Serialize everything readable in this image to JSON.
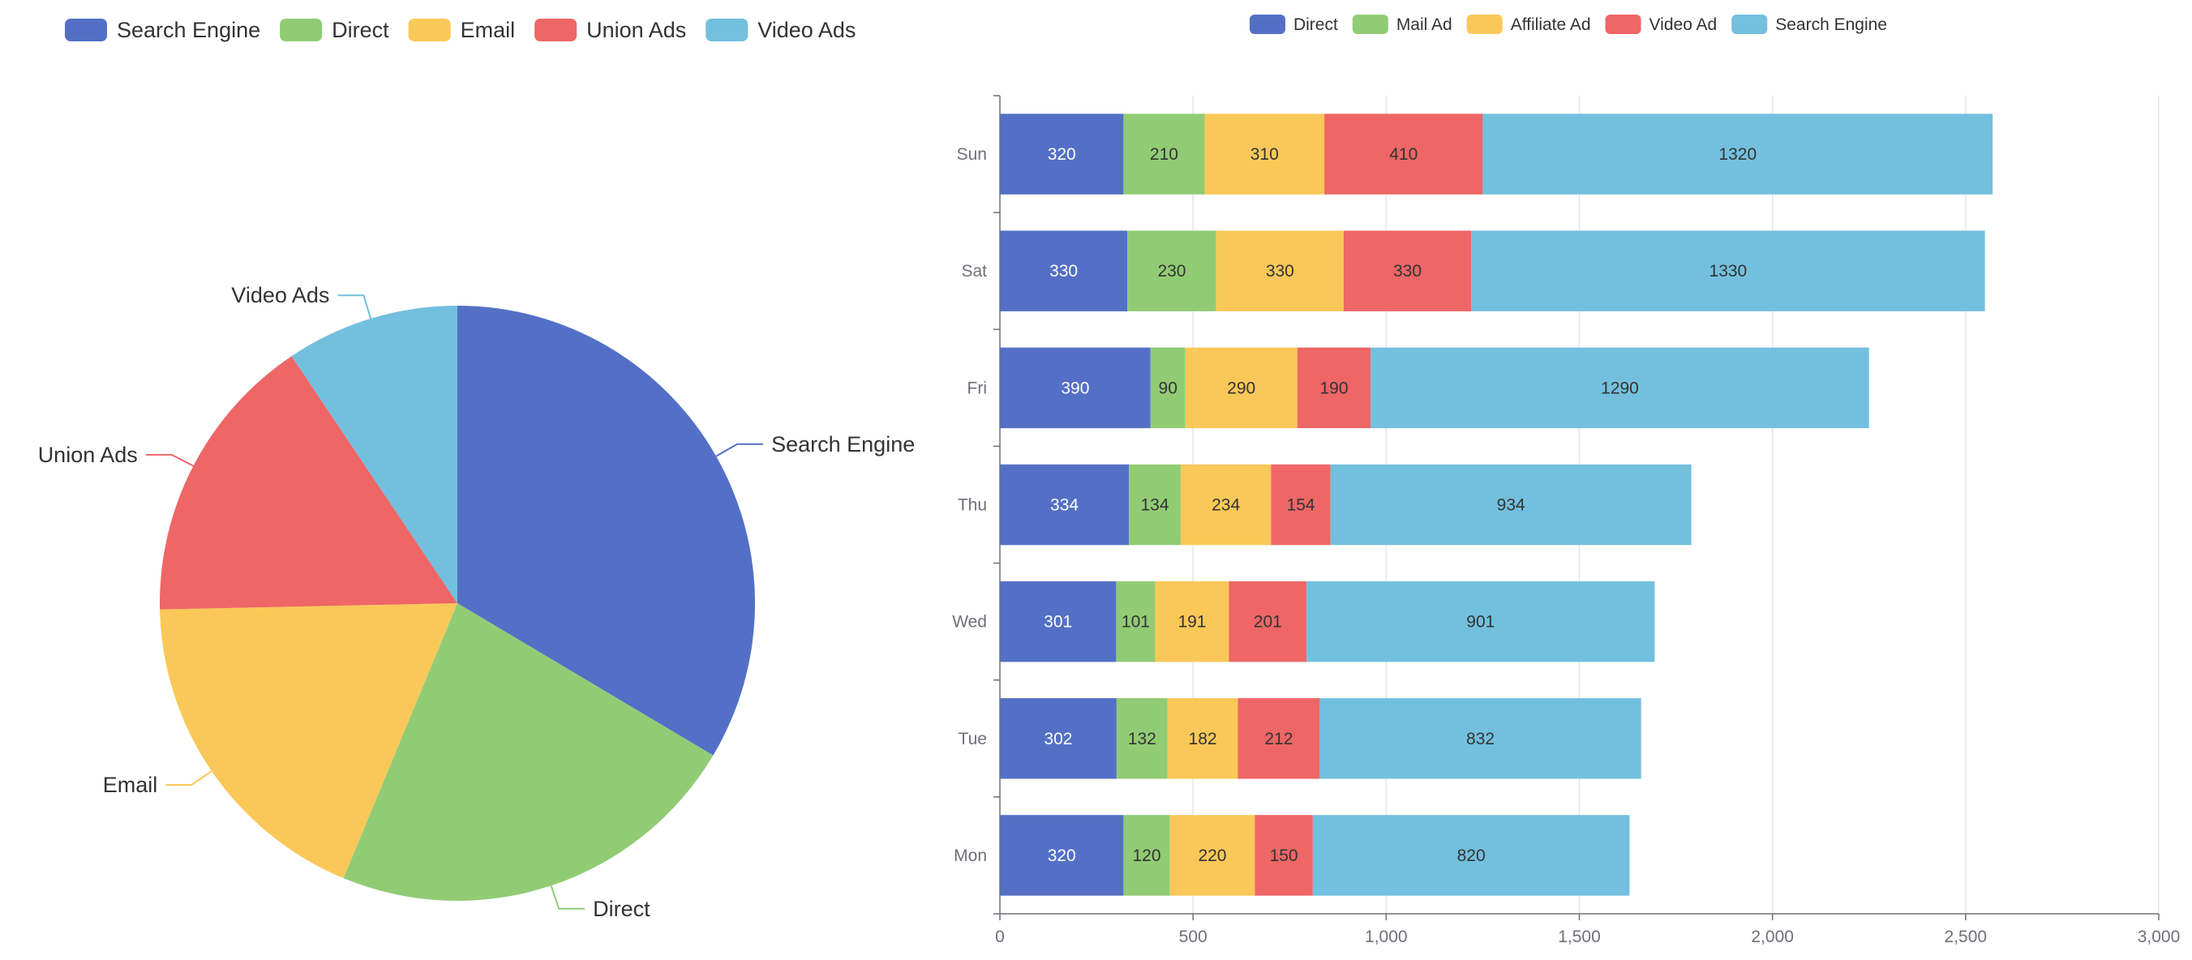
{
  "colors": {
    "blue": "#5470c6",
    "green": "#91cc75",
    "yellow": "#fac858",
    "red": "#ee6666",
    "cyan": "#73c0de",
    "axis": "#6e7079",
    "grid": "#e0e6f1"
  },
  "chart_data": [
    {
      "type": "pie",
      "title": "",
      "legend_position": "top-left",
      "slices": [
        {
          "name": "Search Engine",
          "value": 1548,
          "color": "#5470c6"
        },
        {
          "name": "Direct",
          "value": 1048,
          "color": "#91cc75"
        },
        {
          "name": "Email",
          "value": 850,
          "color": "#fac858"
        },
        {
          "name": "Union Ads",
          "value": 735,
          "color": "#ee6666"
        },
        {
          "name": "Video Ads",
          "value": 434,
          "color": "#73c0de"
        }
      ]
    },
    {
      "type": "bar",
      "orientation": "horizontal",
      "stacked": true,
      "title": "",
      "legend_position": "top-center",
      "categories": [
        "Mon",
        "Tue",
        "Wed",
        "Thu",
        "Fri",
        "Sat",
        "Sun"
      ],
      "xlim": [
        0,
        3000
      ],
      "x_ticks": [
        0,
        500,
        1000,
        1500,
        2000,
        2500,
        3000
      ],
      "x_tick_labels": [
        "0",
        "500",
        "1,000",
        "1,500",
        "2,000",
        "2,500",
        "3,000"
      ],
      "grid": true,
      "series": [
        {
          "name": "Direct",
          "color": "#5470c6",
          "label_color": "#ffffff",
          "values": [
            320,
            302,
            301,
            334,
            390,
            330,
            320
          ]
        },
        {
          "name": "Mail Ad",
          "color": "#91cc75",
          "label_color": "#333333",
          "values": [
            120,
            132,
            101,
            134,
            90,
            230,
            210
          ]
        },
        {
          "name": "Affiliate Ad",
          "color": "#fac858",
          "label_color": "#333333",
          "values": [
            220,
            182,
            191,
            234,
            290,
            330,
            310
          ]
        },
        {
          "name": "Video Ad",
          "color": "#ee6666",
          "label_color": "#333333",
          "values": [
            150,
            212,
            201,
            154,
            190,
            330,
            410
          ]
        },
        {
          "name": "Search Engine",
          "color": "#73c0de",
          "label_color": "#333333",
          "values": [
            820,
            832,
            901,
            934,
            1290,
            1330,
            1320
          ]
        }
      ]
    }
  ]
}
